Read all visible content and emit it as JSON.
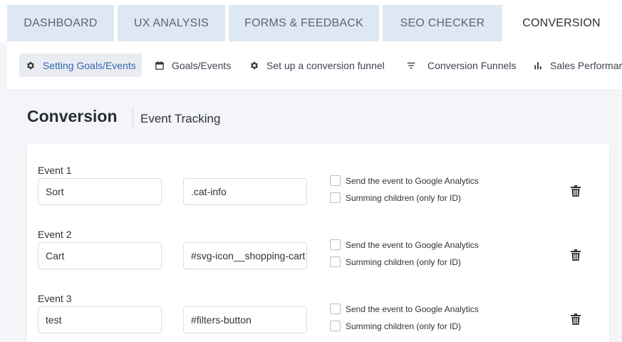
{
  "tabs": [
    {
      "label": "DASHBOARD"
    },
    {
      "label": "UX ANALYSIS"
    },
    {
      "label": "FORMS & FEEDBACK"
    },
    {
      "label": "SEO CHECKER"
    },
    {
      "label": "CONVERSION"
    }
  ],
  "subnav": [
    {
      "label": "Setting Goals/Events",
      "icon": "gear-icon"
    },
    {
      "label": "Goals/Events",
      "icon": "calendar-icon"
    },
    {
      "label": "Set up a conversion funnel",
      "icon": "gear-icon"
    },
    {
      "label": "Conversion Funnels",
      "icon": "filter-icon"
    },
    {
      "label": "Sales Performar",
      "icon": "bar-chart-icon"
    }
  ],
  "page": {
    "title": "Conversion",
    "subtitle": "Event Tracking"
  },
  "events": [
    {
      "label": "Event 1",
      "name": "Sort",
      "selector": ".cat-info",
      "ga_label": "Send the event to Google Analytics",
      "sum_label": "Summing children (only for ID)"
    },
    {
      "label": "Event 2",
      "name": "Cart",
      "selector": "#svg-icon__shopping-cart",
      "ga_label": "Send the event to Google Analytics",
      "sum_label": "Summing children (only for ID)"
    },
    {
      "label": "Event 3",
      "name": "test",
      "selector": "#filters-button",
      "ga_label": "Send the event to Google Analytics",
      "sum_label": "Summing children (only for ID)"
    }
  ],
  "colors": {
    "accent": "#3567b0",
    "tab_bg": "#dde8f3",
    "page_bg": "#f3f5f8"
  }
}
